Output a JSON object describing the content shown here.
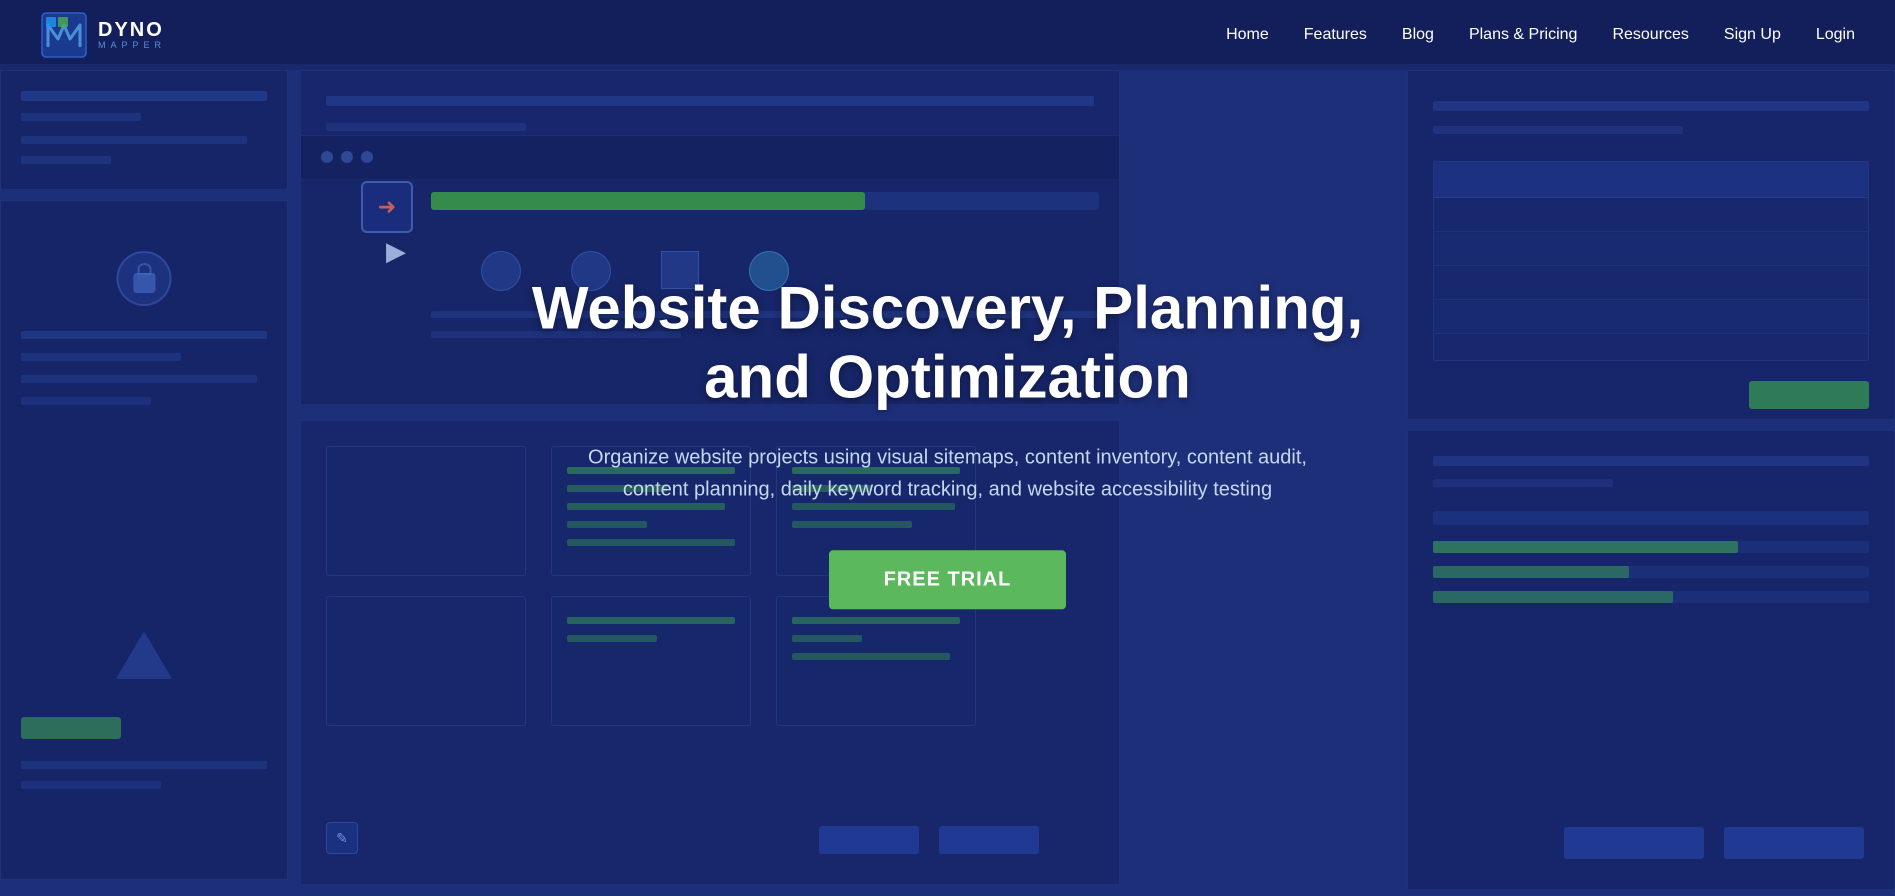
{
  "brand": {
    "name": "DYNO",
    "subtitle": "MAPPER",
    "logo_text": "DYNO MAPPER"
  },
  "nav": {
    "links": [
      {
        "label": "Home",
        "id": "home"
      },
      {
        "label": "Features",
        "id": "features"
      },
      {
        "label": "Blog",
        "id": "blog"
      },
      {
        "label": "Plans & Pricing",
        "id": "plans"
      },
      {
        "label": "Resources",
        "id": "resources"
      },
      {
        "label": "Sign Up",
        "id": "signup"
      },
      {
        "label": "Login",
        "id": "login"
      }
    ]
  },
  "hero": {
    "title_line1": "Website Discovery, Planning,",
    "title_line2": "and Optimization",
    "subtitle": "Organize website projects using visual sitemaps, content inventory, content audit,\ncontent planning, daily keyword tracking, and website accessibility testing",
    "cta_label": "FREE TRIAL"
  },
  "colors": {
    "background": "#1a2a6c",
    "accent_green": "#5cb85c",
    "nav_text": "#ffffff",
    "body_text": "#c5d8f0"
  }
}
